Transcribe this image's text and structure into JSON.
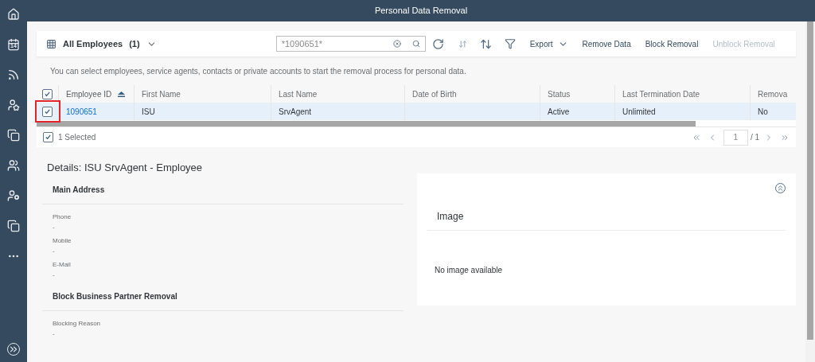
{
  "header": {
    "title": "Personal Data Removal"
  },
  "sidebar": {
    "calendar_day": "14"
  },
  "toolbar": {
    "view_title": "All Employees",
    "count": "(1)",
    "search_value": "*1090651*",
    "actions": [
      {
        "label": "Export",
        "kind": "menu",
        "disabled": false
      },
      {
        "label": "Remove Data",
        "kind": "plain",
        "disabled": false
      },
      {
        "label": "Block Removal",
        "kind": "plain",
        "disabled": false
      },
      {
        "label": "Unblock Removal",
        "kind": "plain",
        "disabled": true
      }
    ]
  },
  "info_text": "You can select employees, service agents, contacts or private accounts to start the removal process for personal data.",
  "table": {
    "all_checked": true,
    "columns": [
      {
        "label": "Employee ID",
        "sorted": true
      },
      {
        "label": "First Name",
        "sorted": false
      },
      {
        "label": "Last Name",
        "sorted": false
      },
      {
        "label": "Date of Birth",
        "sorted": false
      },
      {
        "label": "Status",
        "sorted": false
      },
      {
        "label": "Last Termination Date",
        "sorted": false
      },
      {
        "label": "Remova",
        "sorted": false
      }
    ],
    "rows": [
      {
        "selected": true,
        "cells": [
          "1090651",
          "ISU",
          "SrvAgent",
          "",
          "Active",
          "Unlimited",
          "No"
        ]
      }
    ]
  },
  "footer": {
    "selected_checked": true,
    "selected_text": "1 Selected",
    "page": "1",
    "page_total": "/ 1"
  },
  "details": {
    "title": "Details: ISU SrvAgent - Employee",
    "sections": [
      {
        "title": "Main Address",
        "fields": [
          {
            "label": "Phone",
            "value": "-"
          },
          {
            "label": "Mobile",
            "value": "-"
          },
          {
            "label": "E-Mail",
            "value": "-"
          }
        ]
      },
      {
        "title": "Block Business Partner Removal",
        "fields": [
          {
            "label": "Blocking Reason",
            "value": "-"
          }
        ]
      }
    ],
    "image": {
      "title": "Image",
      "empty_text": "No image available"
    }
  }
}
